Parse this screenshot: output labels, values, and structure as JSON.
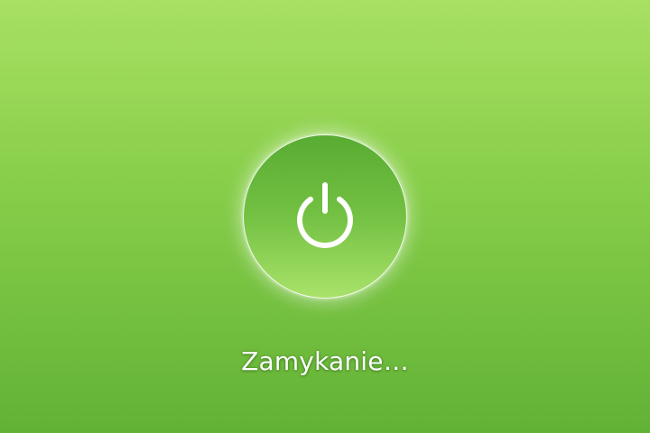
{
  "shutdown_screen": {
    "status_text": "Zamykanie…",
    "icon": "power-icon",
    "colors": {
      "background_top": "#a8e063",
      "background_bottom": "#62b236",
      "button_top": "#58ac32",
      "button_bottom": "#a9e26a",
      "foreground": "#ffffff"
    }
  }
}
